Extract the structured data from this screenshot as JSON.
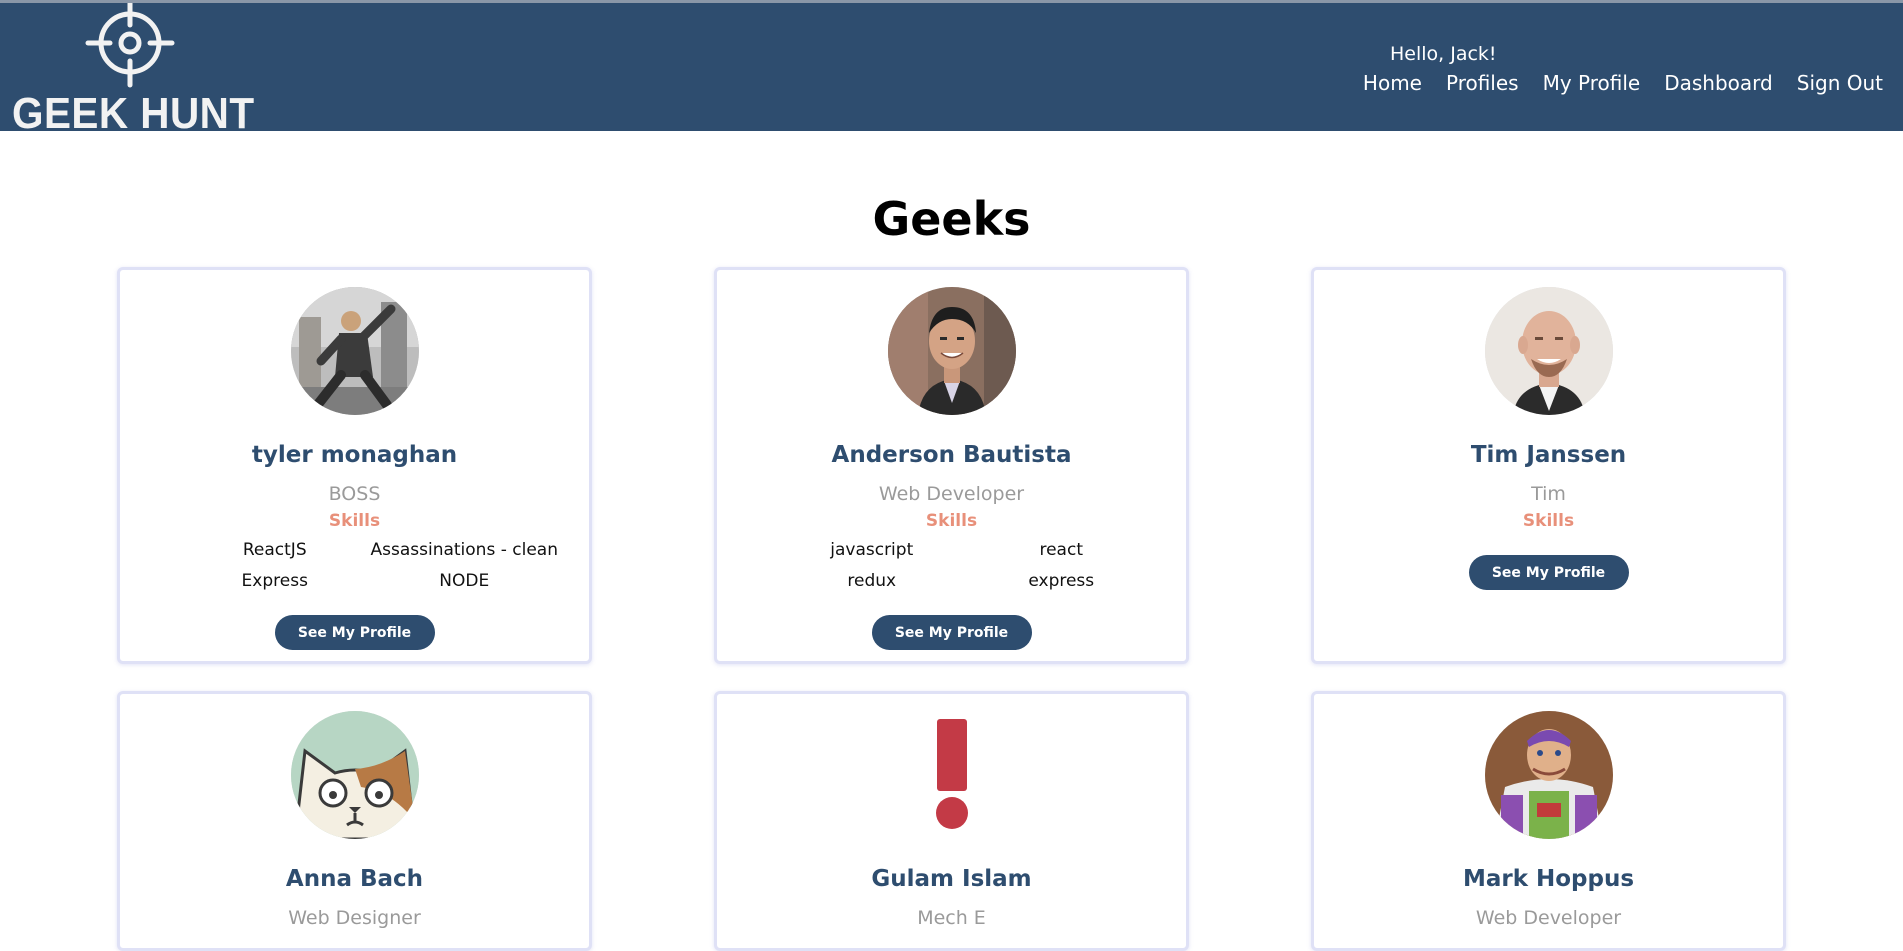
{
  "header": {
    "logo_text": "GEEK HUNT",
    "greeting": "Hello, Jack!",
    "nav": [
      "Home",
      "Profiles",
      "My Profile",
      "Dashboard",
      "Sign Out"
    ]
  },
  "page_title": "Geeks",
  "skills_label": "Skills",
  "button_label": "See My Profile",
  "colors": {
    "header_bg": "#2e4d6f",
    "accent": "#e8907a",
    "name": "#2e4d6f",
    "card_border": "#dfe1f6"
  },
  "geeks": [
    {
      "name": "tyler monaghan",
      "tagline": "BOSS",
      "skills": [
        "ReactJS",
        "Assassinations - clean",
        "Express",
        "NODE"
      ],
      "avatar": "photo-person-action-icon"
    },
    {
      "name": "Anderson Bautista",
      "tagline": "Web Developer",
      "skills": [
        "javascript",
        "react",
        "redux",
        "express"
      ],
      "avatar": "photo-person-smiling-icon"
    },
    {
      "name": "Tim Janssen",
      "tagline": "Tim",
      "skills": [],
      "avatar": "photo-person-bald-icon"
    },
    {
      "name": "Anna Bach",
      "tagline": "Web Designer",
      "skills": [],
      "avatar": "cartoon-cat-icon"
    },
    {
      "name": "Gulam Islam",
      "tagline": "Mech E",
      "skills": [],
      "avatar": "exclamation-icon"
    },
    {
      "name": "Mark Hoppus",
      "tagline": "Web Developer",
      "skills": [],
      "avatar": "photo-toy-figure-icon"
    }
  ]
}
